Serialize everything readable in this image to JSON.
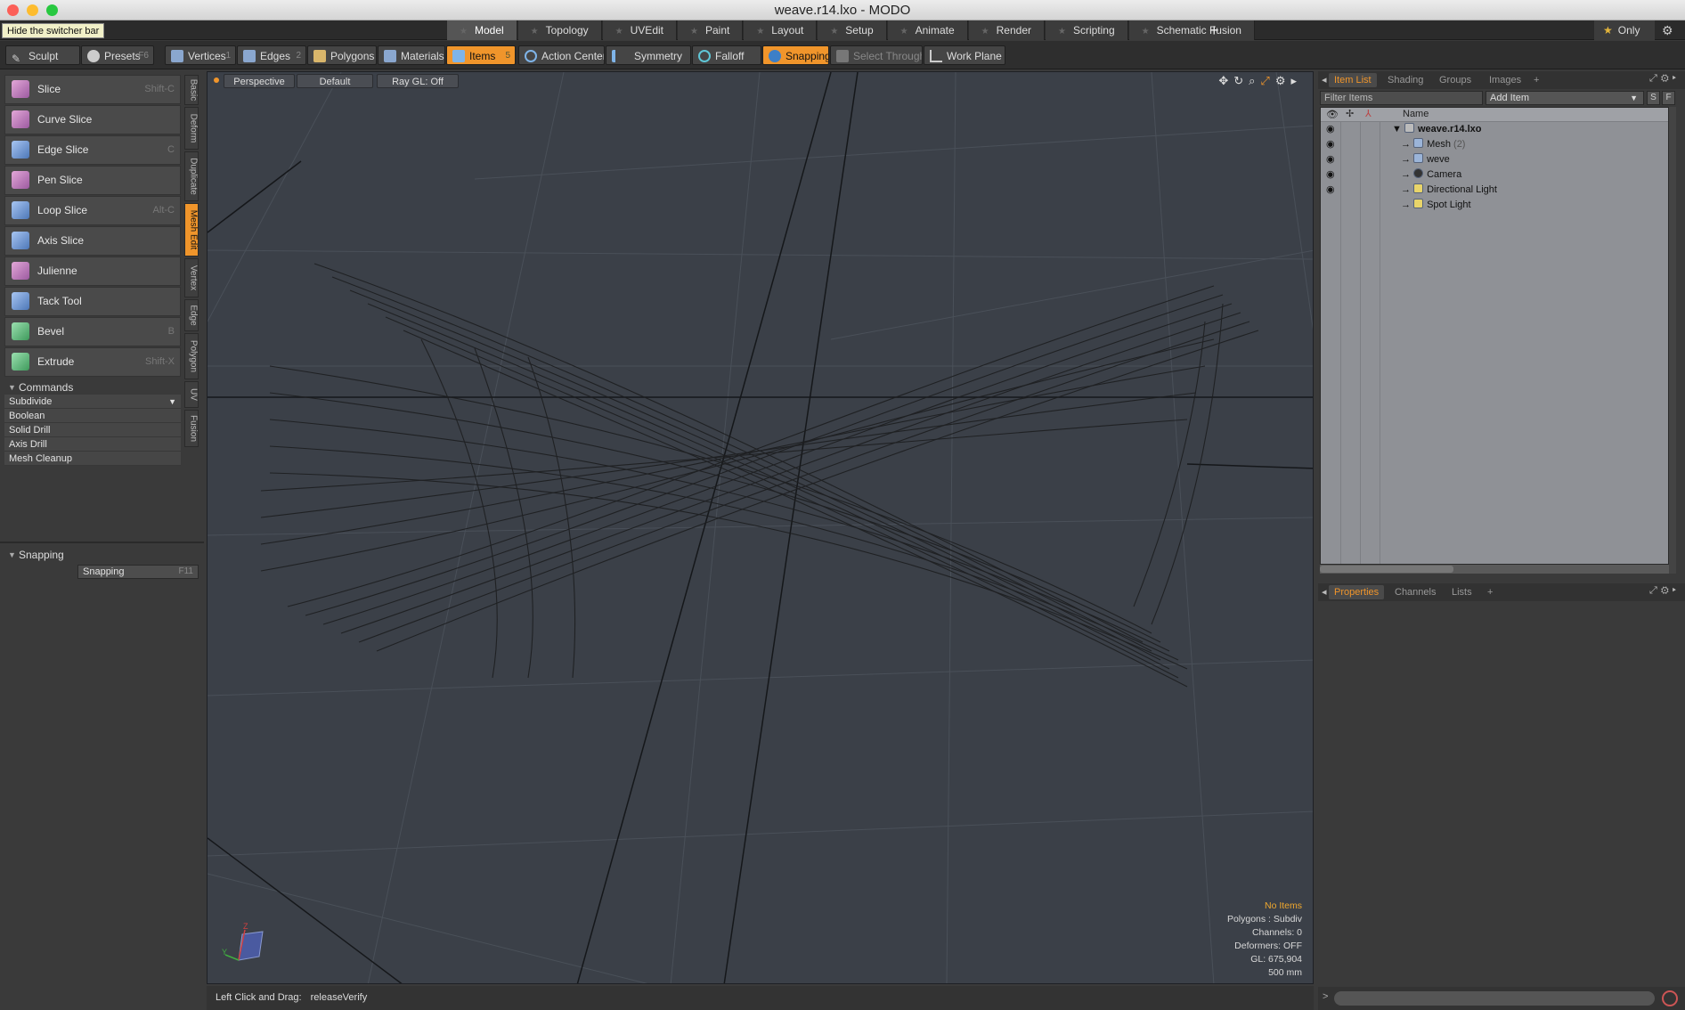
{
  "window": {
    "title": "weave.r14.lxo - MODO"
  },
  "switcher": {
    "hide_label": "Hide the switcher bar",
    "tabs": [
      "Model",
      "Topology",
      "UVEdit",
      "Paint",
      "Layout",
      "Setup",
      "Animate",
      "Render",
      "Scripting",
      "Schematic Fusion"
    ],
    "only_label": "Only"
  },
  "toolbar": {
    "sculpt": "Sculpt",
    "presets": "Presets",
    "presets_key": "F6",
    "vertices": "Vertices",
    "vertices_key": "1",
    "edges": "Edges",
    "edges_key": "2",
    "polygons": "Polygons",
    "materials": "Materials",
    "items": "Items",
    "items_key": "5",
    "action_center": "Action Center",
    "symmetry": "Symmetry",
    "falloff": "Falloff",
    "snapping": "Snapping",
    "select_through": "Select Through",
    "work_plane": "Work Plane"
  },
  "left": {
    "tools": [
      {
        "label": "Slice",
        "key": "Shift-C"
      },
      {
        "label": "Curve Slice",
        "key": ""
      },
      {
        "label": "Edge Slice",
        "key": "C"
      },
      {
        "label": "Pen Slice",
        "key": ""
      },
      {
        "label": "Loop Slice",
        "key": "Alt-C"
      },
      {
        "label": "Axis Slice",
        "key": ""
      },
      {
        "label": "Julienne",
        "key": ""
      },
      {
        "label": "Tack Tool",
        "key": ""
      },
      {
        "label": "Bevel",
        "key": "B"
      },
      {
        "label": "Extrude",
        "key": "Shift-X"
      }
    ],
    "vtabs": [
      "Basic",
      "Deform",
      "Duplicate",
      "Mesh Edit",
      "Vertex",
      "Edge",
      "Polygon",
      "UV",
      "Fusion"
    ],
    "commands_header": "Commands",
    "commands": [
      "Subdivide",
      "Boolean",
      "Solid Drill",
      "Axis Drill",
      "Mesh Cleanup"
    ],
    "snapping_header": "Snapping",
    "snapping_button": "Snapping",
    "snapping_key": "F11"
  },
  "viewport": {
    "view": "Perspective",
    "style": "Default",
    "raygl": "Ray GL: Off",
    "stats": {
      "items": "No Items",
      "polygons": "Polygons : Subdiv",
      "channels": "Channels: 0",
      "deformers": "Deformers: OFF",
      "gl": "GL: 675,904",
      "scale": "500 mm"
    }
  },
  "status": {
    "label": "Left Click and Drag:",
    "value": "releaseVerify"
  },
  "right": {
    "tabs": [
      "Item List",
      "Shading",
      "Groups",
      "Images"
    ],
    "filter_placeholder": "Filter Items",
    "add_item": "Add Item",
    "s_btn": "S",
    "f_btn": "F",
    "name_col": "Name",
    "items": [
      {
        "label": "weave.r14.lxo",
        "count": ""
      },
      {
        "label": "Mesh",
        "count": "(2)"
      },
      {
        "label": "weve",
        "count": ""
      },
      {
        "label": "Camera",
        "count": ""
      },
      {
        "label": "Directional Light",
        "count": ""
      },
      {
        "label": "Spot Light",
        "count": ""
      }
    ],
    "bottom_tabs": [
      "Properties",
      "Channels",
      "Lists"
    ]
  },
  "colors": {
    "accent": "#f0952b",
    "viewport_bg": "#3b4048",
    "panel_bg": "#3a3a3a",
    "stat_highlight": "#f0a82e"
  }
}
